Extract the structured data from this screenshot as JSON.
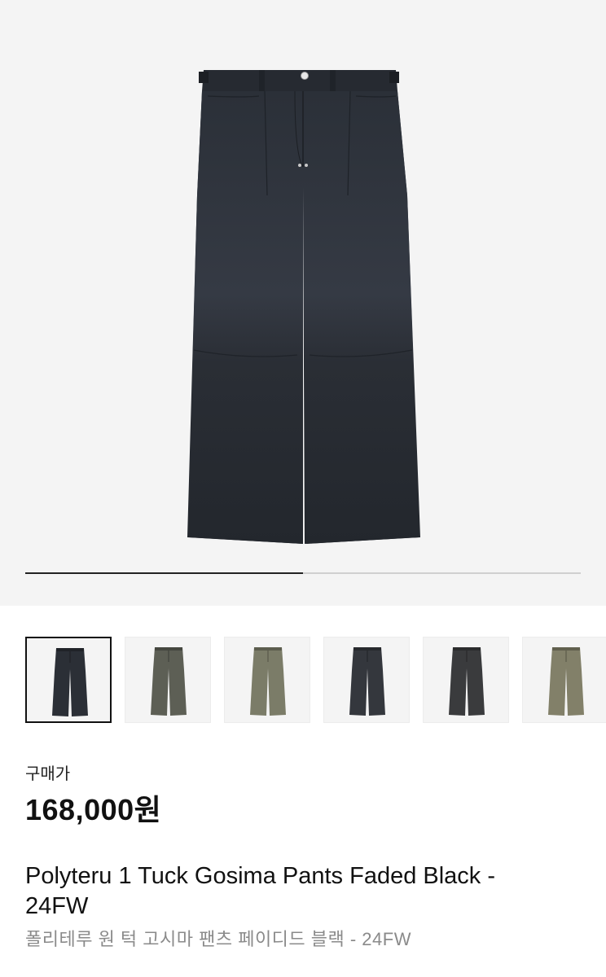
{
  "product_image": {
    "current_slide": 1,
    "total_slides": 2,
    "progress_fraction": 0.5
  },
  "thumbnails": [
    {
      "label": "faded-black",
      "color": "#2b2f36",
      "selected": true
    },
    {
      "label": "olive-grey",
      "color": "#5d5f55",
      "selected": false
    },
    {
      "label": "khaki",
      "color": "#7b7c68",
      "selected": false
    },
    {
      "label": "charcoal",
      "color": "#34373d",
      "selected": false
    },
    {
      "label": "black",
      "color": "#3a3b3d",
      "selected": false
    },
    {
      "label": "khaki-2",
      "color": "#828069",
      "selected": false
    }
  ],
  "price": {
    "label": "구매가",
    "value": "168,000원"
  },
  "product": {
    "name_en": "Polyteru 1 Tuck Gosima Pants Faded Black - 24FW",
    "name_ko": "폴리테루 원 턱 고시마 팬츠 페이디드 블랙 - 24FW"
  }
}
